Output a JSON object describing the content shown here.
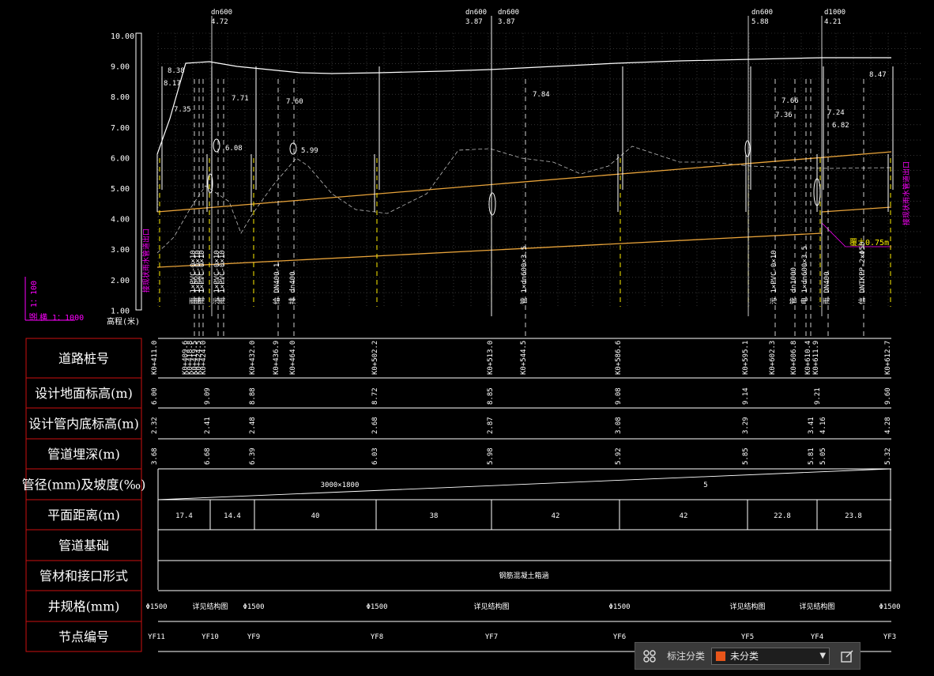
{
  "colors": {
    "background": "#000000",
    "line": "#ffffff",
    "grid": "#555555",
    "pipe": "#e8a33a",
    "label_box": "#cc1111",
    "magenta": "#ff00ff",
    "blue": "#3355ff",
    "yellow": "#ffee00",
    "swatch": "#e8551a"
  },
  "scale": {
    "vertical": "竖 1：100",
    "horizontal": "横 1：1000"
  },
  "axis": {
    "y_ticks": [
      "10.00",
      "9.00",
      "8.00",
      "7.00",
      "6.00",
      "5.00",
      "4.00",
      "3.00",
      "2.00",
      "1.00"
    ],
    "unit": "高程(米)"
  },
  "pipe_tags": [
    {
      "size": "dn600",
      "value": "4.72"
    },
    {
      "size": "dn600",
      "value": "3.87"
    },
    {
      "size": "dn600",
      "value": "3.87"
    },
    {
      "size": "dn600",
      "value": "5.88"
    },
    {
      "size": "d1000",
      "value": "4.21"
    }
  ],
  "elevation_labels": [
    "8.38",
    "8.17",
    "7.35",
    "7.71",
    "6.08",
    "7.60",
    "5.99",
    "7.84",
    "7.66",
    "7.36",
    "7.24",
    "6.82",
    "8.47"
  ],
  "annotations": {
    "cover_depth": "覆土0.75m",
    "left_note": "接现状雨水管道出口",
    "right_note": "接现状雨水管道出口"
  },
  "crossing_labels": [
    "雨 1×PVC-0×10",
    "雨 1×PVC-0×10",
    "雨 1×PVC-0×10",
    "污 1×PVC-0×10",
    "雨 1×PVC-0×10",
    "给 DN400-1",
    "排 dn400",
    "管 1×dn600×3.5",
    "污 1×PVC-0×10",
    "管 dn1000",
    "电 1×dn600×3.5",
    "雨 DN400",
    "信 DNTKPP-2×Φ50"
  ],
  "table_labels": [
    "道路桩号",
    "设计地面标高(m)",
    "设计管内底标高(m)",
    "管道埋深(m)",
    "管径(mm)及坡度(‰)",
    "平面距离(m)",
    "管道基础",
    "管材和接口形式",
    "井规格(mm)",
    "节点编号"
  ],
  "stations": [
    "K0+411.0",
    "K0+409.6",
    "K0+418.8",
    "K0+419.5",
    "K0+424.5",
    "K0+424.0",
    "K0+432.0",
    "K0+436.9",
    "K0+464.0",
    "K0+502.2",
    "K0+513.0",
    "K0+544.5",
    "K0+586.6",
    "K0+595.1",
    "K0+602.3",
    "K0+606.8",
    "K0+610.4",
    "K0+611.9",
    "K0+612.7"
  ],
  "ground_elev": [
    "6.00",
    "9.09",
    "8.88",
    "8.72",
    "8.85",
    "9.08",
    "9.14",
    "9.21",
    "9.60"
  ],
  "invert_elev": [
    "2.32",
    "2.41",
    "2.48",
    "2.68",
    "2.87",
    "3.08",
    "3.29",
    "3.41",
    "4.16",
    "4.28"
  ],
  "depth": [
    "3.68",
    "6.68",
    "6.39",
    "6.03",
    "5.98",
    "5.92",
    "5.85",
    "5.81",
    "5.05",
    "5.32"
  ],
  "pipe_size": "3000×1800",
  "slope": "5",
  "distances": [
    "17.4",
    "14.4",
    "40",
    "38",
    "42",
    "42",
    "22.8",
    "23.8"
  ],
  "material": "钢筋混凝土箱涵",
  "wells": [
    "Φ1500",
    "详见结构图",
    "Φ1500",
    "Φ1500",
    "详见结构图",
    "Φ1500",
    "详见结构图",
    "详见结构图",
    "Φ1500"
  ],
  "nodes": [
    "YF11",
    "YF10",
    "YF9",
    "YF8",
    "YF7",
    "YF6",
    "YF5",
    "YF4",
    "YF3"
  ],
  "toolbar": {
    "label": "标注分类",
    "selected": "未分类"
  }
}
